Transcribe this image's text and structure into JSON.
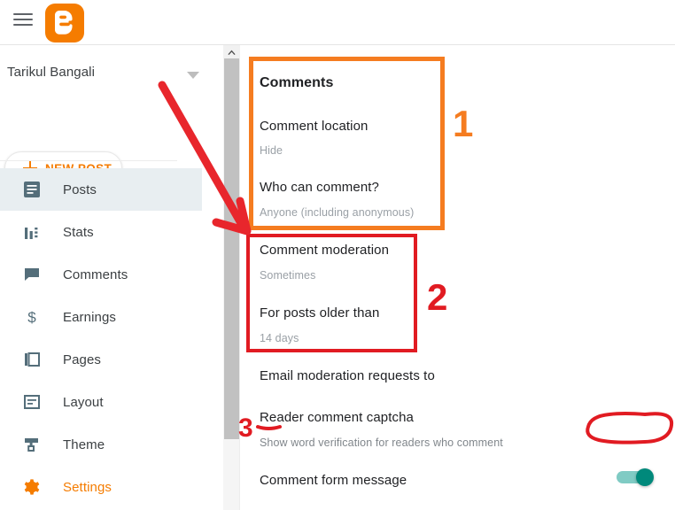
{
  "app": {
    "brand": "Blogger",
    "menu_icon": "hamburger-menu-icon",
    "logo_icon": "blogger-logo-icon"
  },
  "sidebar": {
    "account_name": "Tarikul Bangali",
    "account_caret_icon": "chevron-down-icon",
    "new_post": {
      "label": "NEW POST",
      "icon": "plus-icon"
    },
    "items": [
      {
        "label": "Posts",
        "icon": "posts-icon",
        "active": true
      },
      {
        "label": "Stats",
        "icon": "stats-icon",
        "active": false
      },
      {
        "label": "Comments",
        "icon": "comments-icon",
        "active": false
      },
      {
        "label": "Earnings",
        "icon": "dollar-icon",
        "active": false
      },
      {
        "label": "Pages",
        "icon": "pages-icon",
        "active": false
      },
      {
        "label": "Layout",
        "icon": "layout-icon",
        "active": false
      },
      {
        "label": "Theme",
        "icon": "theme-icon",
        "active": false
      },
      {
        "label": "Settings",
        "icon": "gear-icon",
        "active": false,
        "highlighted": true
      }
    ]
  },
  "scrollbar": {
    "up_icon": "chevron-up-icon"
  },
  "main": {
    "section_title": "Comments",
    "settings": [
      {
        "label": "Comment location",
        "value": "Hide"
      },
      {
        "label": "Who can comment?",
        "value": "Anyone (including anonymous)"
      },
      {
        "label": "Comment moderation",
        "value": "Sometimes"
      },
      {
        "label": "For posts older than",
        "value": "14 days"
      },
      {
        "label": "Email moderation requests to",
        "value": ""
      }
    ],
    "captcha": {
      "label": "Reader comment captcha",
      "description": "Show word verification for readers who comment",
      "toggle_state": "on"
    },
    "comment_form_message": "Comment form message"
  },
  "annotations": {
    "marker_1": "1",
    "marker_2": "2",
    "marker_3": "3",
    "box1_color": "#f57c20",
    "box2_color": "#e11b22",
    "arrow_color": "#e8262c",
    "circle_color": "#e11b22"
  },
  "colors": {
    "brand_orange": "#f57c00",
    "toggle_on": "#00897b",
    "toggle_track": "#80cbc4",
    "active_nav_bg": "#e8eef1",
    "text_primary": "#202124",
    "text_secondary": "#9aa0a6"
  }
}
